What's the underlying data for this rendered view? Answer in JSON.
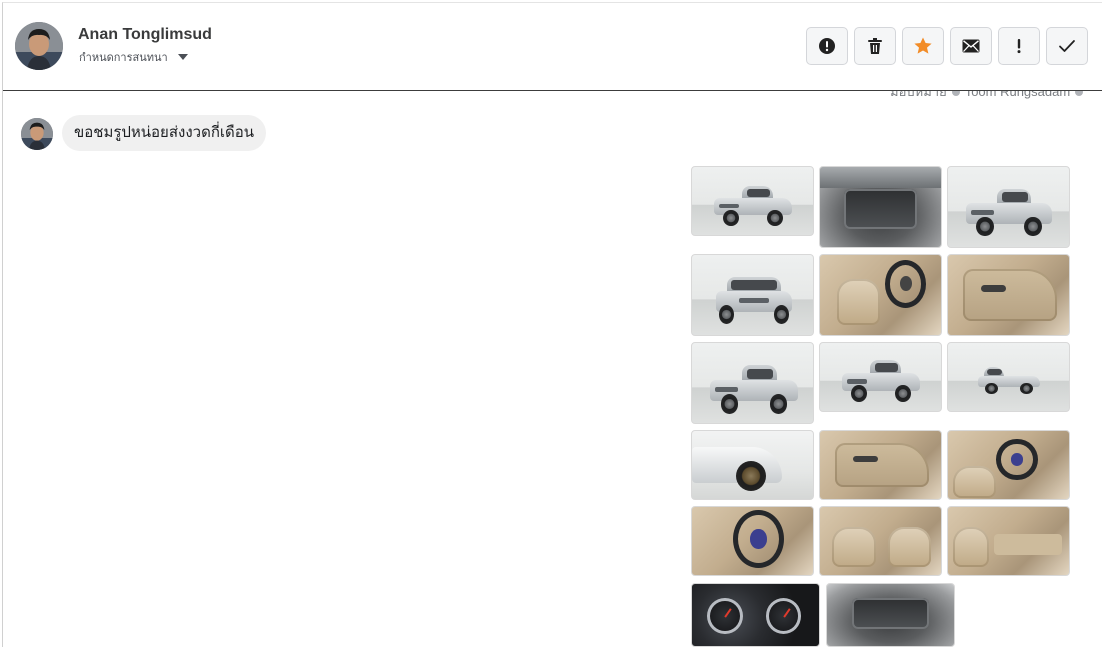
{
  "header": {
    "contact_name": "Anan Tonglimsud",
    "conversation_setting_label": "กำหนดการสนทนา",
    "toolbar": [
      {
        "name": "report-button",
        "icon": "alert-circle-icon"
      },
      {
        "name": "delete-button",
        "icon": "trash-icon"
      },
      {
        "name": "star-button",
        "icon": "star-icon",
        "color": "#f28c28"
      },
      {
        "name": "mark-unread-button",
        "icon": "envelope-icon"
      },
      {
        "name": "important-button",
        "icon": "exclamation-icon"
      },
      {
        "name": "mark-done-button",
        "icon": "check-icon"
      }
    ]
  },
  "assigned": {
    "prefix": "มอบหมาย",
    "assignee": "Toom Rungsadam"
  },
  "messages": [
    {
      "direction": "incoming",
      "text": "ขอชมรูปหน่อยส่งงวดกี่เดือน"
    }
  ],
  "attachments": {
    "photos": [
      {
        "subject": "pickup-front-quarter"
      },
      {
        "subject": "engine-bay-hood-open"
      },
      {
        "subject": "pickup-front-quarter"
      },
      {
        "subject": "pickup-front"
      },
      {
        "subject": "front-seats"
      },
      {
        "subject": "door-panel"
      },
      {
        "subject": "pickup-front-quarter"
      },
      {
        "subject": "pickup-front-quarter"
      },
      {
        "subject": "pickup-side"
      },
      {
        "subject": "front-fender"
      },
      {
        "subject": "door-panel"
      },
      {
        "subject": "dashboard-steering"
      },
      {
        "subject": "steering-wheel"
      },
      {
        "subject": "front-seats"
      },
      {
        "subject": "rear-cab-seat"
      },
      {
        "subject": "gauge-cluster"
      },
      {
        "subject": "engine-bay"
      }
    ]
  },
  "colors": {
    "accent_star": "#f28c28",
    "bubble_bg": "#f0f0f0",
    "header_border": "#3c3c3c"
  }
}
